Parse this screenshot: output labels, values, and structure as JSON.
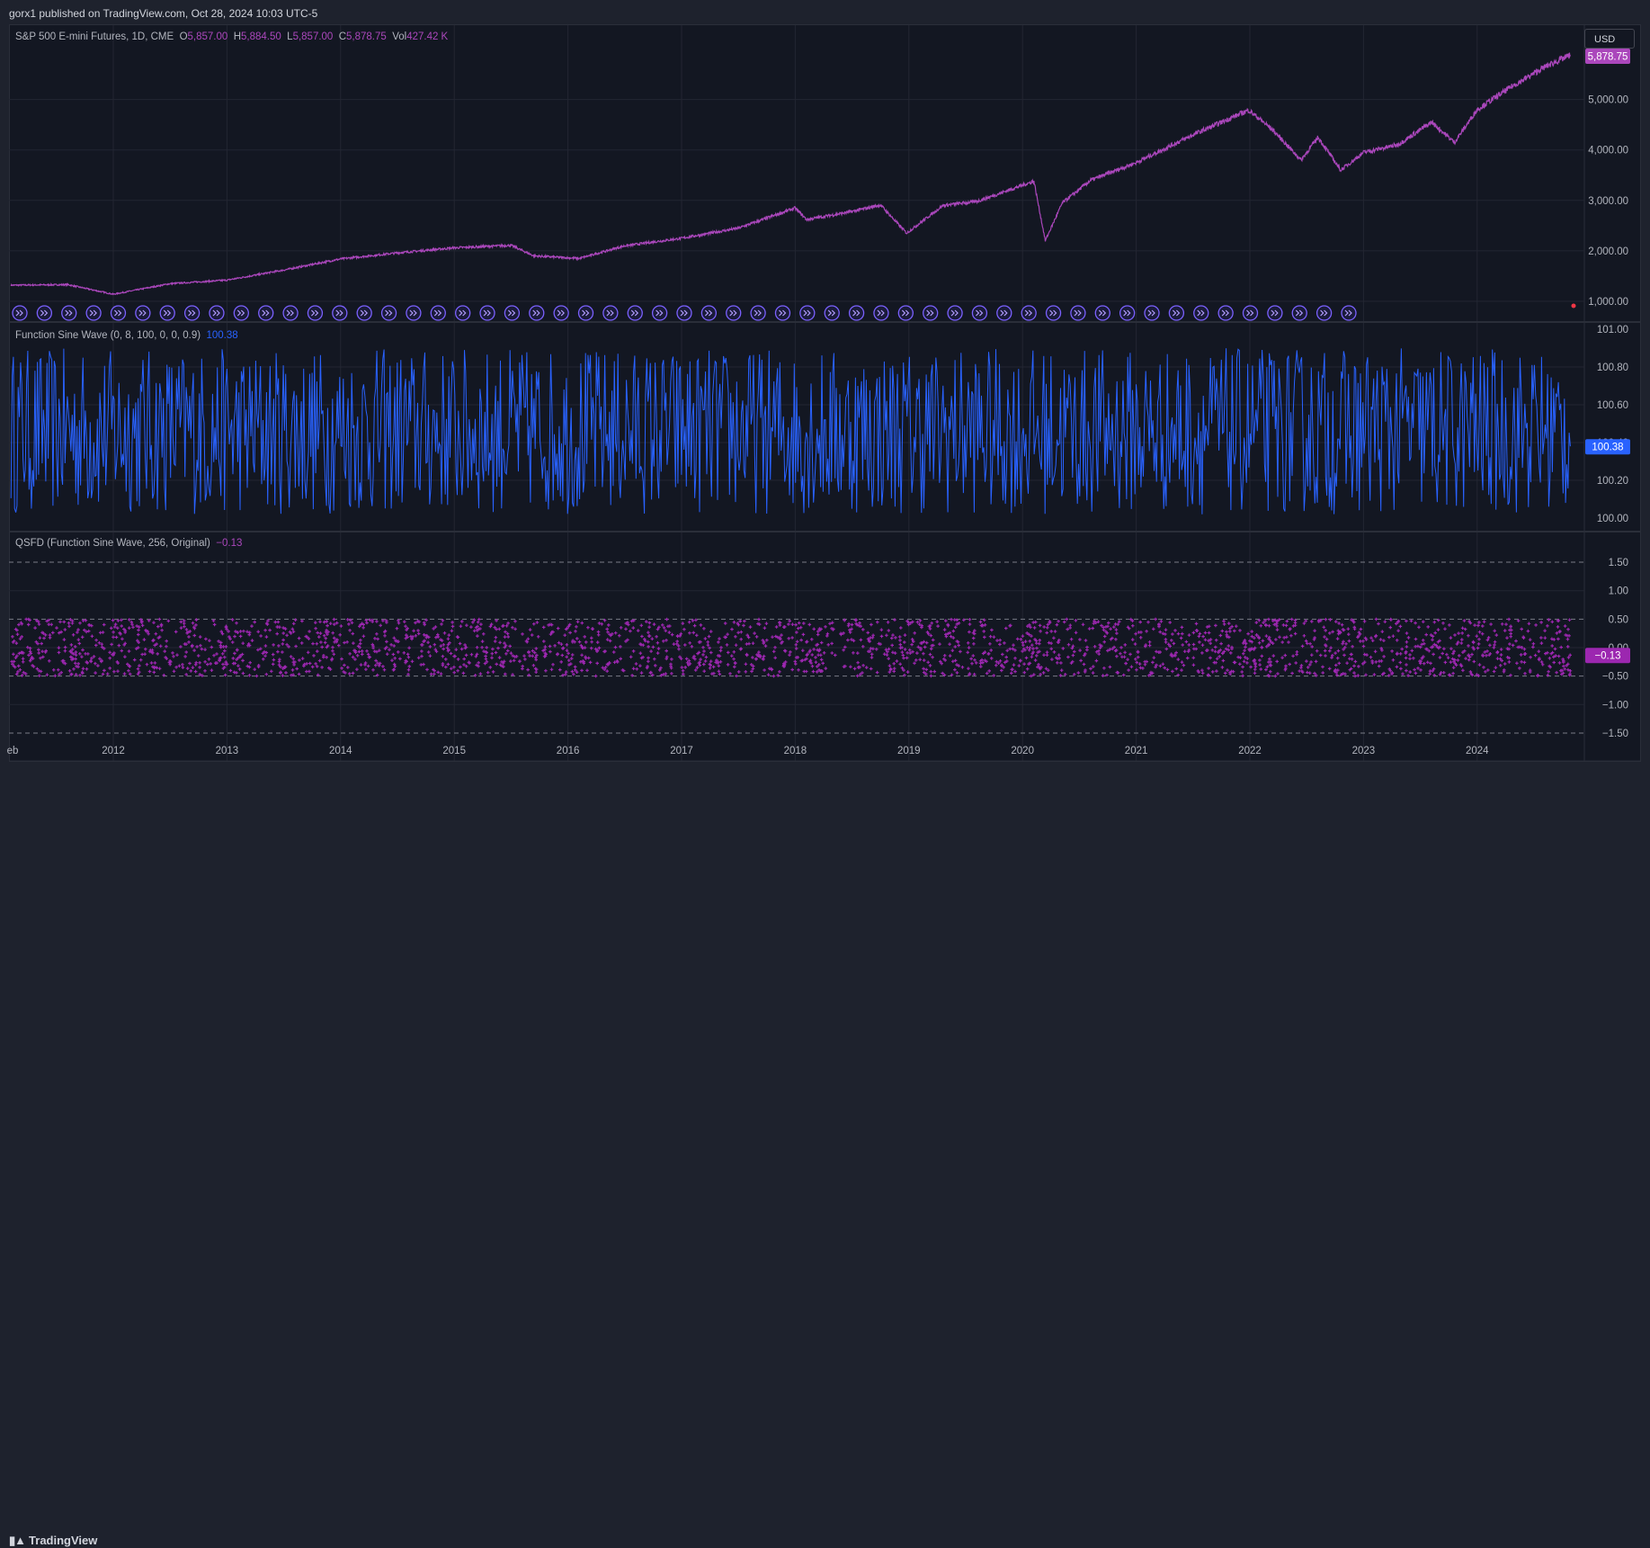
{
  "header": {
    "publish_text": "gorx1 published on TradingView.com, Oct 28, 2024 10:03 UTC-5"
  },
  "currency_button": "USD",
  "footer": {
    "logo_text": "TradingView"
  },
  "colors": {
    "price_line": "#ab47bc",
    "sine_line": "#2962ff",
    "qsfd_marks": "#9c27b0",
    "background": "#131722",
    "grid": "#232632"
  },
  "legend": {
    "symbol": "S&P 500 E-mini Futures, 1D, CME",
    "o_label": "O",
    "o_value": "5,857.00",
    "h_label": "H",
    "h_value": "5,884.50",
    "l_label": "L",
    "l_value": "5,857.00",
    "c_label": "C",
    "c_value": "5,878.75",
    "vol_label": "Vol",
    "vol_value": "427.42 K",
    "sine_title": "Function Sine Wave (0, 8, 100, 0, 0, 0.9)",
    "sine_value": "100.38",
    "qsfd_title": "QSFD (Function Sine Wave, 256, Original)",
    "qsfd_value": "−0.13"
  },
  "chart_data": [
    {
      "type": "line",
      "title": "S&P 500 E-mini Futures, 1D, CME",
      "series": [
        {
          "name": "S&P 500 E-mini Futures",
          "x": [
            2011.1,
            2011.6,
            2012.0,
            2012.5,
            2013.0,
            2013.5,
            2014.0,
            2014.5,
            2015.0,
            2015.5,
            2015.7,
            2016.1,
            2016.5,
            2017.0,
            2017.5,
            2018.0,
            2018.1,
            2018.5,
            2018.75,
            2018.98,
            2019.3,
            2019.6,
            2020.1,
            2020.2,
            2020.35,
            2020.6,
            2021.0,
            2021.5,
            2021.99,
            2022.2,
            2022.45,
            2022.6,
            2022.8,
            2023.0,
            2023.3,
            2023.6,
            2023.8,
            2024.0,
            2024.3,
            2024.6,
            2024.82
          ],
          "y": [
            1320,
            1330,
            1140,
            1350,
            1420,
            1620,
            1840,
            1960,
            2060,
            2110,
            1900,
            1850,
            2100,
            2250,
            2450,
            2850,
            2620,
            2780,
            2910,
            2350,
            2900,
            2980,
            3380,
            2200,
            2950,
            3400,
            3750,
            4300,
            4790,
            4400,
            3800,
            4250,
            3600,
            3950,
            4100,
            4550,
            4150,
            4800,
            5250,
            5650,
            5879
          ]
        }
      ],
      "last_value_label": "5,878.75",
      "y_ticks": [
        "1,000.00",
        "2,000.00",
        "3,000.00",
        "4,000.00",
        "5,000.00"
      ],
      "ylim": [
        1000,
        5900
      ]
    },
    {
      "type": "line",
      "title": "Function Sine Wave (0, 8, 100, 0, 0, 0.9)",
      "ylim": [
        100.0,
        101.0
      ],
      "value_range": [
        100.02,
        100.9
      ],
      "last_value_label": "100.38",
      "y_ticks": [
        "100.00",
        "100.20",
        "100.40",
        "100.60",
        "100.80",
        "101.00"
      ]
    },
    {
      "type": "scatter",
      "title": "QSFD (Function Sine Wave, 256, Original)",
      "ylim": [
        -1.6,
        1.6
      ],
      "value_range": [
        -0.5,
        0.5
      ],
      "reference_lines": [
        1.5,
        0.5,
        -0.5,
        -1.5
      ],
      "last_value_label": "−0.13",
      "y_ticks": [
        "1.50",
        "1.00",
        "0.50",
        "0.00",
        "−0.50",
        "−1.00",
        "−1.50"
      ]
    }
  ],
  "x_axis": {
    "labels": [
      "eb",
      "2012",
      "2013",
      "2014",
      "2015",
      "2016",
      "2017",
      "2018",
      "2019",
      "2020",
      "2021",
      "2022",
      "2023",
      "2024"
    ]
  }
}
